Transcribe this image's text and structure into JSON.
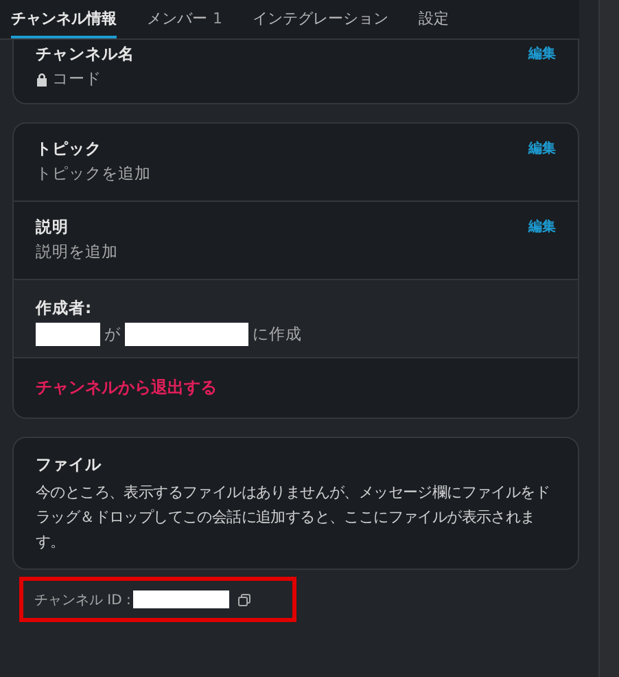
{
  "tabs": [
    {
      "label": "チャンネル情報",
      "selected": true
    },
    {
      "label": "メンバー",
      "count": "1",
      "selected": false
    },
    {
      "label": "インテグレーション",
      "selected": false
    },
    {
      "label": "設定",
      "selected": false
    }
  ],
  "name_card": {
    "title": "チャンネル名",
    "value": "コード",
    "edit": "編集"
  },
  "details": {
    "topic": {
      "title": "トピック",
      "value": "トピックを追加",
      "edit": "編集"
    },
    "description": {
      "title": "説明",
      "value": "説明を追加",
      "edit": "編集"
    },
    "creator": {
      "title": "作成者:",
      "between": "が",
      "suffix": "に作成"
    },
    "leave": "チャンネルから退出する"
  },
  "files": {
    "title": "ファイル",
    "text": "今のところ、表示するファイルはありませんが、メッセージ欄にファイルをドラッグ＆ドロップしてこの会話に追加すると、ここにファイルが表示されます。"
  },
  "channel_id": {
    "label": "チャンネル ID :"
  }
}
